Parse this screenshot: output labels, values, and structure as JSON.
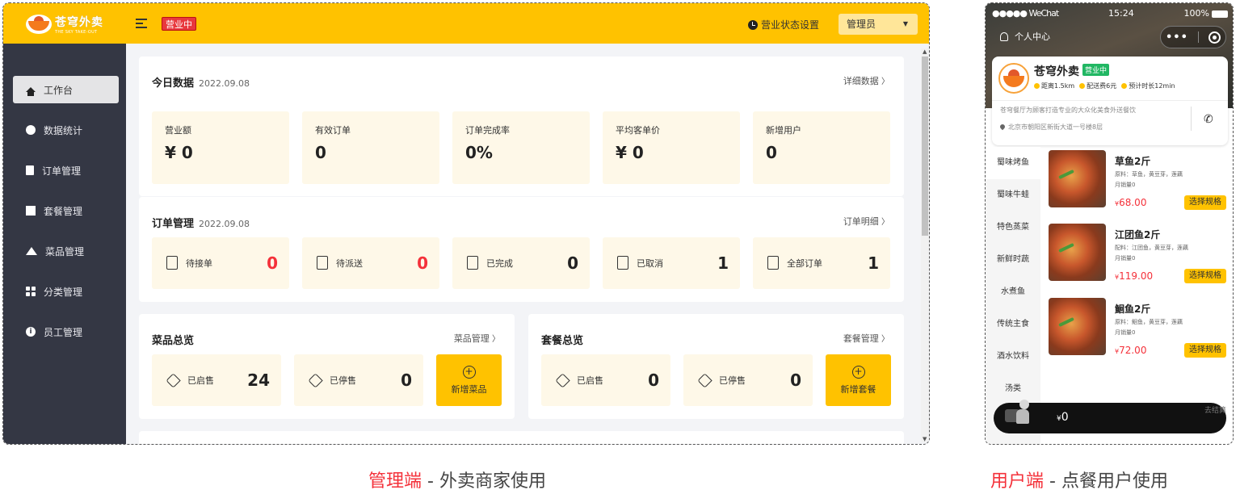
{
  "admin": {
    "logo": {
      "cn": "苍穹外卖",
      "en": "THE SKY TAKE-OUT"
    },
    "status_tag": "营业中",
    "biz_setting": "营业状态设置",
    "user": "管理员",
    "sidebar": [
      {
        "label": "工作台",
        "icon": "home-icon"
      },
      {
        "label": "数据统计",
        "icon": "chart-icon"
      },
      {
        "label": "订单管理",
        "icon": "clipboard-icon"
      },
      {
        "label": "套餐管理",
        "icon": "gift-icon"
      },
      {
        "label": "菜品管理",
        "icon": "dish-icon"
      },
      {
        "label": "分类管理",
        "icon": "grid-icon"
      },
      {
        "label": "员工管理",
        "icon": "info-icon"
      }
    ],
    "today": {
      "title": "今日数据",
      "date": "2022.09.08",
      "link": "详细数据",
      "metrics": [
        {
          "label": "营业额",
          "value": "¥ 0"
        },
        {
          "label": "有效订单",
          "value": "0"
        },
        {
          "label": "订单完成率",
          "value": "0%"
        },
        {
          "label": "平均客单价",
          "value": "¥ 0"
        },
        {
          "label": "新增用户",
          "value": "0"
        }
      ]
    },
    "orders": {
      "title": "订单管理",
      "date": "2022.09.08",
      "link": "订单明细",
      "items": [
        {
          "label": "待接单",
          "value": "0",
          "highlight": true
        },
        {
          "label": "待派送",
          "value": "0",
          "highlight": true
        },
        {
          "label": "已完成",
          "value": "0",
          "highlight": false
        },
        {
          "label": "已取消",
          "value": "1",
          "highlight": false
        },
        {
          "label": "全部订单",
          "value": "1",
          "highlight": false
        }
      ]
    },
    "dish_overview": {
      "title": "菜品总览",
      "link": "菜品管理",
      "on_sale_label": "已启售",
      "on_sale": "24",
      "off_sale_label": "已停售",
      "off_sale": "0",
      "add_label": "新增菜品"
    },
    "setmeal_overview": {
      "title": "套餐总览",
      "link": "套餐管理",
      "on_sale_label": "已启售",
      "on_sale": "0",
      "off_sale_label": "已停售",
      "off_sale": "0",
      "add_label": "新增套餐"
    }
  },
  "mobile": {
    "status_bar": {
      "carrier": "●●●●● WeChat",
      "time": "15:24",
      "battery": "100%"
    },
    "personal_center": "个人中心",
    "shop": {
      "name": "苍穹外卖",
      "badge": "营业中",
      "distance": "距离1.5km",
      "delivery_fee": "配送费6元",
      "eta": "预计时长12min",
      "desc": "苍穹餐厅为顾客打造专业的大众化美食外送餐饮",
      "address": "北京市朝阳区新街大道一号楼8层"
    },
    "categories": [
      "蜀味烤鱼",
      "蜀味牛蛙",
      "特色蒸菜",
      "新鲜时蔬",
      "水煮鱼",
      "传统主食",
      "酒水饮料",
      "汤类"
    ],
    "dishes": [
      {
        "name": "草鱼2斤",
        "ingredients": "原料：草鱼，黄豆芽，莲藕",
        "sales": "月销量0",
        "price": "68.00",
        "button": "选择规格"
      },
      {
        "name": "江团鱼2斤",
        "ingredients": "配料：江团鱼，黄豆芽，莲藕",
        "sales": "月销量0",
        "price": "119.00",
        "button": "选择规格"
      },
      {
        "name": "鮰鱼2斤",
        "ingredients": "原料：鮰鱼，黄豆芽，莲藕",
        "sales": "月销量0",
        "price": "72.00",
        "button": "选择规格"
      }
    ],
    "cart": {
      "amount": "0",
      "checkout": "去结算"
    }
  },
  "captions": {
    "admin_hl": "管理端",
    "admin_rest": " - 外卖商家使用",
    "user_hl": "用户端",
    "user_rest": " - 点餐用户使用"
  },
  "colors": {
    "brand": "#ffc200",
    "sidebar": "#343744",
    "danger": "#f4313a",
    "card_bg": "#fef8e8"
  }
}
